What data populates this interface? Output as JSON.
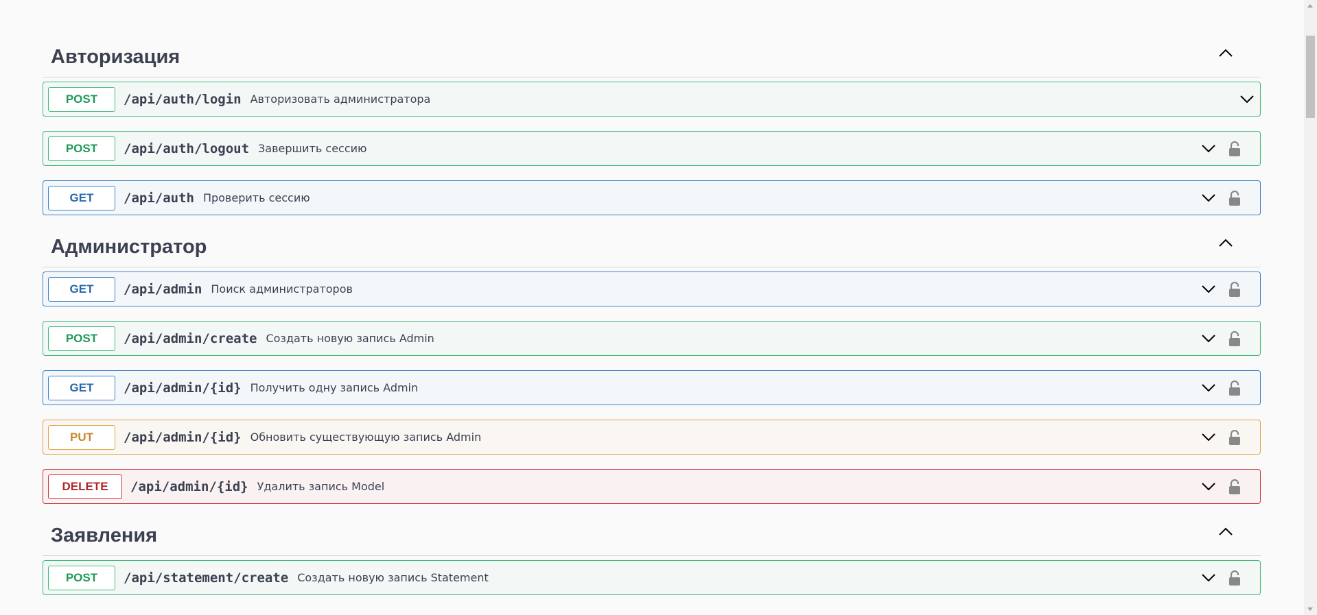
{
  "sections": [
    {
      "title": "Авторизация",
      "operations": [
        {
          "method": "POST",
          "kind": "post",
          "path": "/api/auth/login",
          "summary": "Авторизовать администратора",
          "locked": false
        },
        {
          "method": "POST",
          "kind": "post",
          "path": "/api/auth/logout",
          "summary": "Завершить сессию",
          "locked": true
        },
        {
          "method": "GET",
          "kind": "get",
          "path": "/api/auth",
          "summary": "Проверить сессию",
          "locked": true
        }
      ]
    },
    {
      "title": "Администратор",
      "operations": [
        {
          "method": "GET",
          "kind": "get",
          "path": "/api/admin",
          "summary": "Поиск администраторов",
          "locked": true
        },
        {
          "method": "POST",
          "kind": "post",
          "path": "/api/admin/create",
          "summary": "Создать новую запись Admin",
          "locked": true
        },
        {
          "method": "GET",
          "kind": "get",
          "path": "/api/admin/{id}",
          "summary": "Получить одну запись Admin",
          "locked": true
        },
        {
          "method": "PUT",
          "kind": "put",
          "path": "/api/admin/{id}",
          "summary": "Обновить существующую запись Admin",
          "locked": true
        },
        {
          "method": "DELETE",
          "kind": "delete",
          "path": "/api/admin/{id}",
          "summary": "Удалить запись Model",
          "locked": true
        }
      ]
    },
    {
      "title": "Заявления",
      "operations": [
        {
          "method": "POST",
          "kind": "post",
          "path": "/api/statement/create",
          "summary": "Создать новую запись Statement",
          "locked": true
        }
      ]
    }
  ],
  "icons": {
    "section_toggle": "chevron-up-icon",
    "op_toggle": "chevron-down-icon",
    "lock": "lock-icon"
  },
  "colors": {
    "post": "#3fb97b",
    "get": "#3b80c5",
    "put": "#e3a048",
    "delete": "#c9363a",
    "text": "#3b4151"
  }
}
